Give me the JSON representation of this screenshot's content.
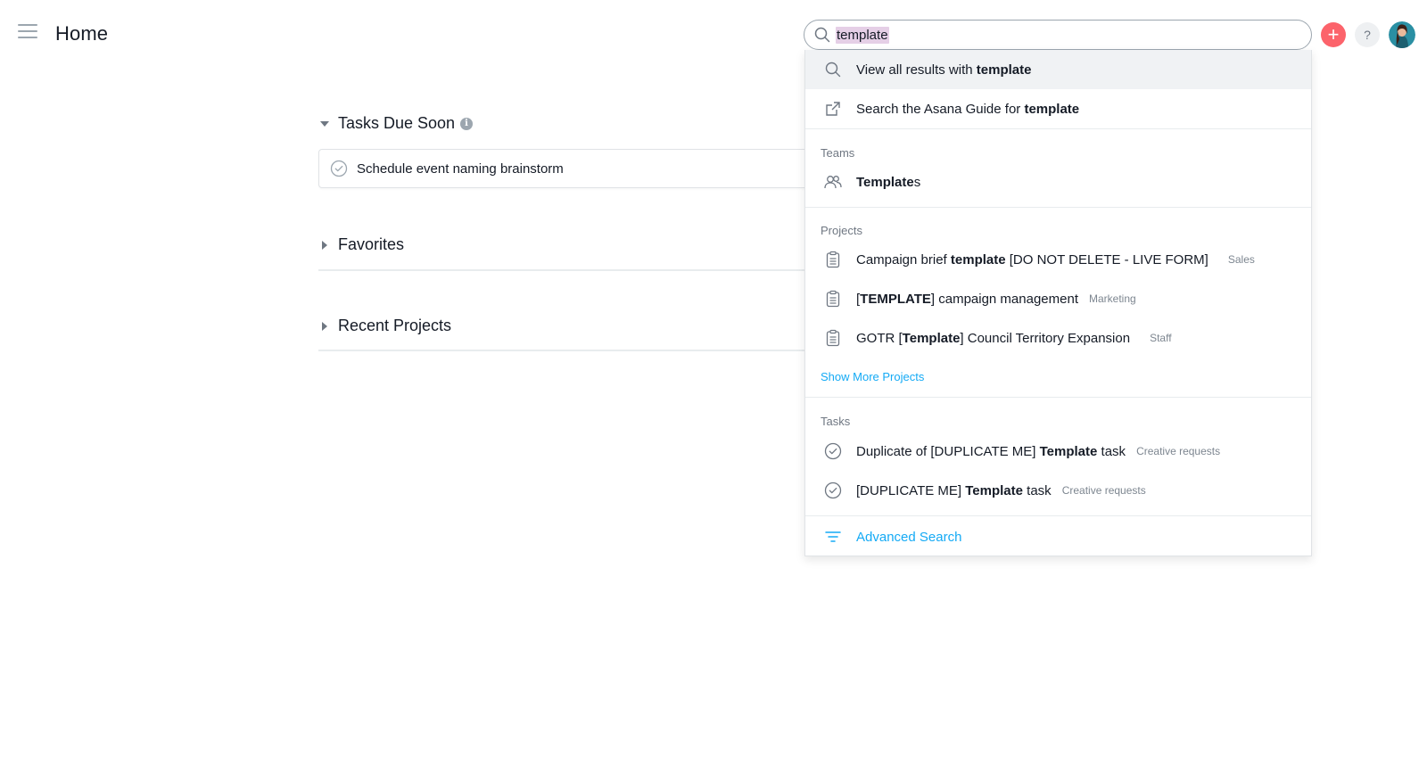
{
  "header": {
    "title": "Home",
    "menu_icon": "hamburger-menu-icon",
    "search": {
      "value": "template",
      "placeholder": "",
      "icon": "search-icon"
    },
    "add_label": "+",
    "help_label": "?",
    "colors": {
      "add": "#fc636b",
      "help_bg": "#eef0f2"
    }
  },
  "main": {
    "tasks_due_soon": {
      "label": "Tasks Due Soon",
      "info_glyph": "i",
      "tasks": [
        {
          "label": "Schedule event naming brainstorm"
        }
      ]
    },
    "favorites": {
      "label": "Favorites"
    },
    "recent_projects": {
      "label": "Recent Projects"
    }
  },
  "search_dropdown": {
    "view_all": {
      "prefix": "View all results with ",
      "term": "template"
    },
    "guide": {
      "prefix": "Search the Asana Guide for ",
      "term": "template"
    },
    "teams": {
      "header": "Teams",
      "items": [
        {
          "bold": "Template",
          "rest": "s"
        }
      ]
    },
    "projects": {
      "header": "Projects",
      "items": [
        {
          "before": "Campaign brief ",
          "bold": "template",
          "after": " [DO NOT DELETE - LIVE FORM]",
          "meta": "Sales"
        },
        {
          "before": "[",
          "bold": "TEMPLATE",
          "after": "] campaign management",
          "meta": "Marketing"
        },
        {
          "before": "GOTR [",
          "bold": "Template",
          "after": "] Council Territory Expansion",
          "meta": "Staff"
        }
      ],
      "show_more": "Show More Projects"
    },
    "tasks": {
      "header": "Tasks",
      "items": [
        {
          "before": "Duplicate of [DUPLICATE ME] ",
          "bold": "Template",
          "after": " task",
          "meta": "Creative requests"
        },
        {
          "before": "[DUPLICATE ME] ",
          "bold": "Template",
          "after": " task",
          "meta": "Creative requests"
        }
      ]
    },
    "advanced_search": "Advanced Search",
    "colors": {
      "link": "#14aaf5",
      "active_row": "#f0f2f4"
    }
  }
}
